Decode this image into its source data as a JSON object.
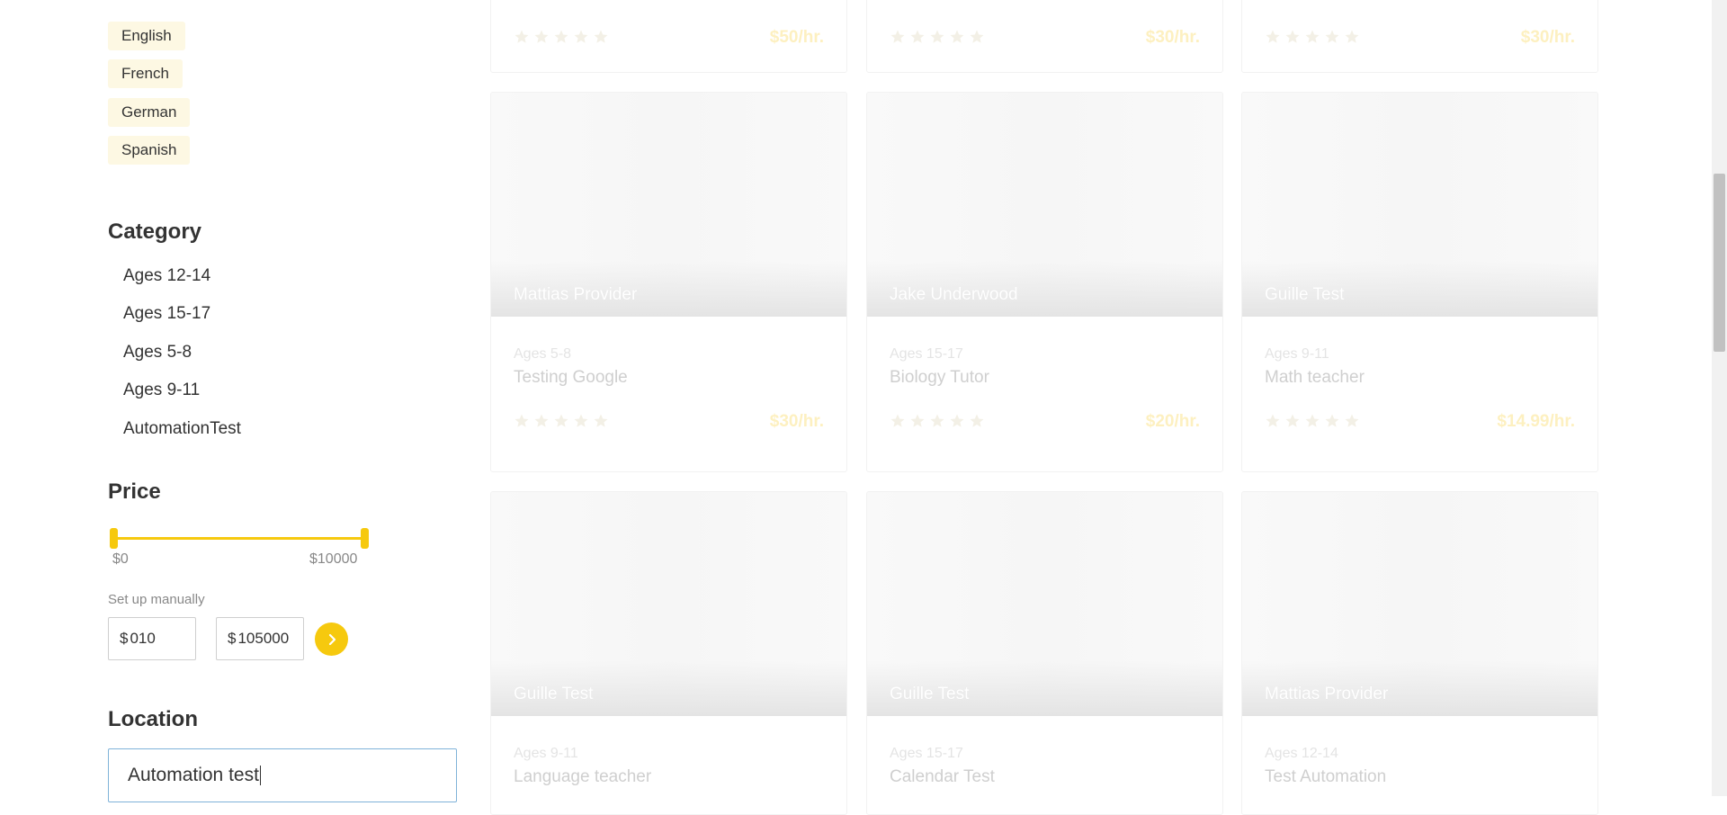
{
  "filters": {
    "languages": [
      "English",
      "French",
      "German",
      "Spanish"
    ],
    "category": {
      "title": "Category",
      "items": [
        "Ages 12-14",
        "Ages 15-17",
        "Ages 5-8",
        "Ages 9-11",
        "AutomationTest"
      ]
    },
    "price": {
      "title": "Price",
      "min_label": "$0",
      "max_label": "$10000",
      "setup_label": "Set up manually",
      "currency": "$",
      "min_value": "010",
      "max_value": "105000"
    },
    "location": {
      "title": "Location",
      "value": "Automation test"
    }
  },
  "cards_top_partial": [
    {
      "price": "$50/hr.",
      "rating": 5
    },
    {
      "price": "$30/hr.",
      "rating": 5
    },
    {
      "price": "$30/hr.",
      "rating": 5
    }
  ],
  "cards": [
    {
      "name": "Mattias Provider",
      "category": "Ages 5-8",
      "title": "Testing Google",
      "price": "$30/hr.",
      "rating": 5
    },
    {
      "name": "Jake Underwood",
      "category": "Ages 15-17",
      "title": "Biology Tutor",
      "price": "$20/hr.",
      "rating": 5
    },
    {
      "name": "Guille Test",
      "category": "Ages 9-11",
      "title": "Math teacher",
      "price": "$14.99/hr.",
      "rating": 5
    },
    {
      "name": "Guille Test",
      "category": "Ages 9-11",
      "title": "Language teacher",
      "price": "",
      "rating": 5
    },
    {
      "name": "Guille Test",
      "category": "Ages 15-17",
      "title": "Calendar Test",
      "price": "",
      "rating": 5
    },
    {
      "name": "Mattias Provider",
      "category": "Ages 12-14",
      "title": "Test Automation",
      "price": "",
      "rating": 5
    }
  ],
  "colors": {
    "accent": "#f6c90e",
    "tag_bg": "#fdf8e3",
    "star": "#f3f0e6"
  }
}
